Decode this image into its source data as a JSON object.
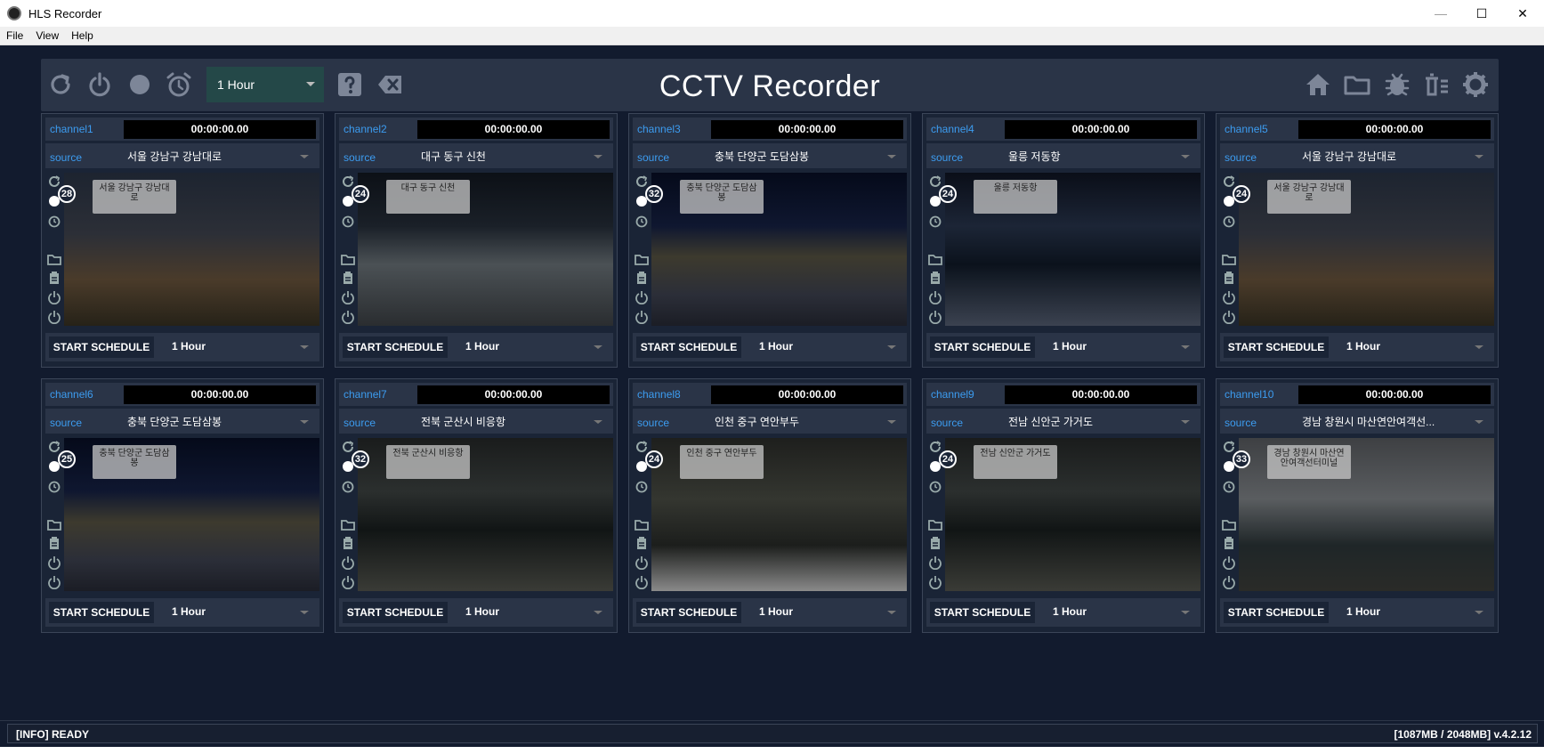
{
  "window": {
    "title": "HLS Recorder",
    "minimize_glyph": "—",
    "maximize_glyph": "☐",
    "close_glyph": "✕"
  },
  "menu": [
    "File",
    "View",
    "Help"
  ],
  "toolbar": {
    "heading": "CCTV Recorder",
    "interval": "1 Hour",
    "left_icons": [
      "refresh-icon",
      "power-icon",
      "record-icon",
      "alarm-clock-icon"
    ],
    "right_icons": [
      "home-icon",
      "folder-icon",
      "bug-icon",
      "trash-list-icon",
      "settings-gear-icon"
    ]
  },
  "colors": {
    "accent_blue": "#3c9cf0",
    "panel_bg": "#1a2436",
    "header_bg": "#2a3447",
    "interval_bg": "#244848"
  },
  "source_label": "source",
  "schedule_button_label": "START SCHEDULE",
  "channels": [
    {
      "name": "channel1",
      "time": "00:00:00.00",
      "source": "서울 강남구 강남대로",
      "overlay": "서울 강남구 강남대로",
      "fps": "28",
      "schedule": "1 Hour",
      "scene": "city"
    },
    {
      "name": "channel2",
      "time": "00:00:00.00",
      "source": "대구 동구 신천",
      "overlay": "대구 동구 신천",
      "fps": "24",
      "schedule": "1 Hour",
      "scene": "road"
    },
    {
      "name": "channel3",
      "time": "00:00:00.00",
      "source": "충북 단양군 도담삼봉",
      "overlay": "충북 단양군 도담삼봉",
      "fps": "32",
      "schedule": "1 Hour",
      "scene": "rocks"
    },
    {
      "name": "channel4",
      "time": "00:00:00.00",
      "source": "울릉 저동항",
      "overlay": "울릉 저동항",
      "fps": "24",
      "schedule": "1 Hour",
      "scene": "harbor"
    },
    {
      "name": "channel5",
      "time": "00:00:00.00",
      "source": "서울 강남구 강남대로",
      "overlay": "서울 강남구 강남대로",
      "fps": "24",
      "schedule": "1 Hour",
      "scene": "city"
    },
    {
      "name": "channel6",
      "time": "00:00:00.00",
      "source": "충북 단양군 도담삼봉",
      "overlay": "충북 단양군 도담삼봉",
      "fps": "25",
      "schedule": "1 Hour",
      "scene": "rocks"
    },
    {
      "name": "channel7",
      "time": "00:00:00.00",
      "source": "전북 군산시 비응항",
      "overlay": "전북 군산시 비응항",
      "fps": "32",
      "schedule": "1 Hour",
      "scene": "port"
    },
    {
      "name": "channel8",
      "time": "00:00:00.00",
      "source": "인천 중구 연안부두",
      "overlay": "인천 중구 연안부두",
      "fps": "24",
      "schedule": "1 Hour",
      "scene": "dock"
    },
    {
      "name": "channel9",
      "time": "00:00:00.00",
      "source": "전남 신안군 가거도",
      "overlay": "전남 신안군 가거도",
      "fps": "24",
      "schedule": "1 Hour",
      "scene": "port"
    },
    {
      "name": "channel10",
      "time": "00:00:00.00",
      "source": "경남 창원시 마산연안여객선...",
      "overlay": "경남 창원시 마산연안여객선터미널",
      "fps": "33",
      "schedule": "1 Hour",
      "scene": "bay"
    }
  ],
  "status": {
    "left": "[INFO] READY",
    "right": "[1087MB / 2048MB]  v.4.2.12"
  }
}
